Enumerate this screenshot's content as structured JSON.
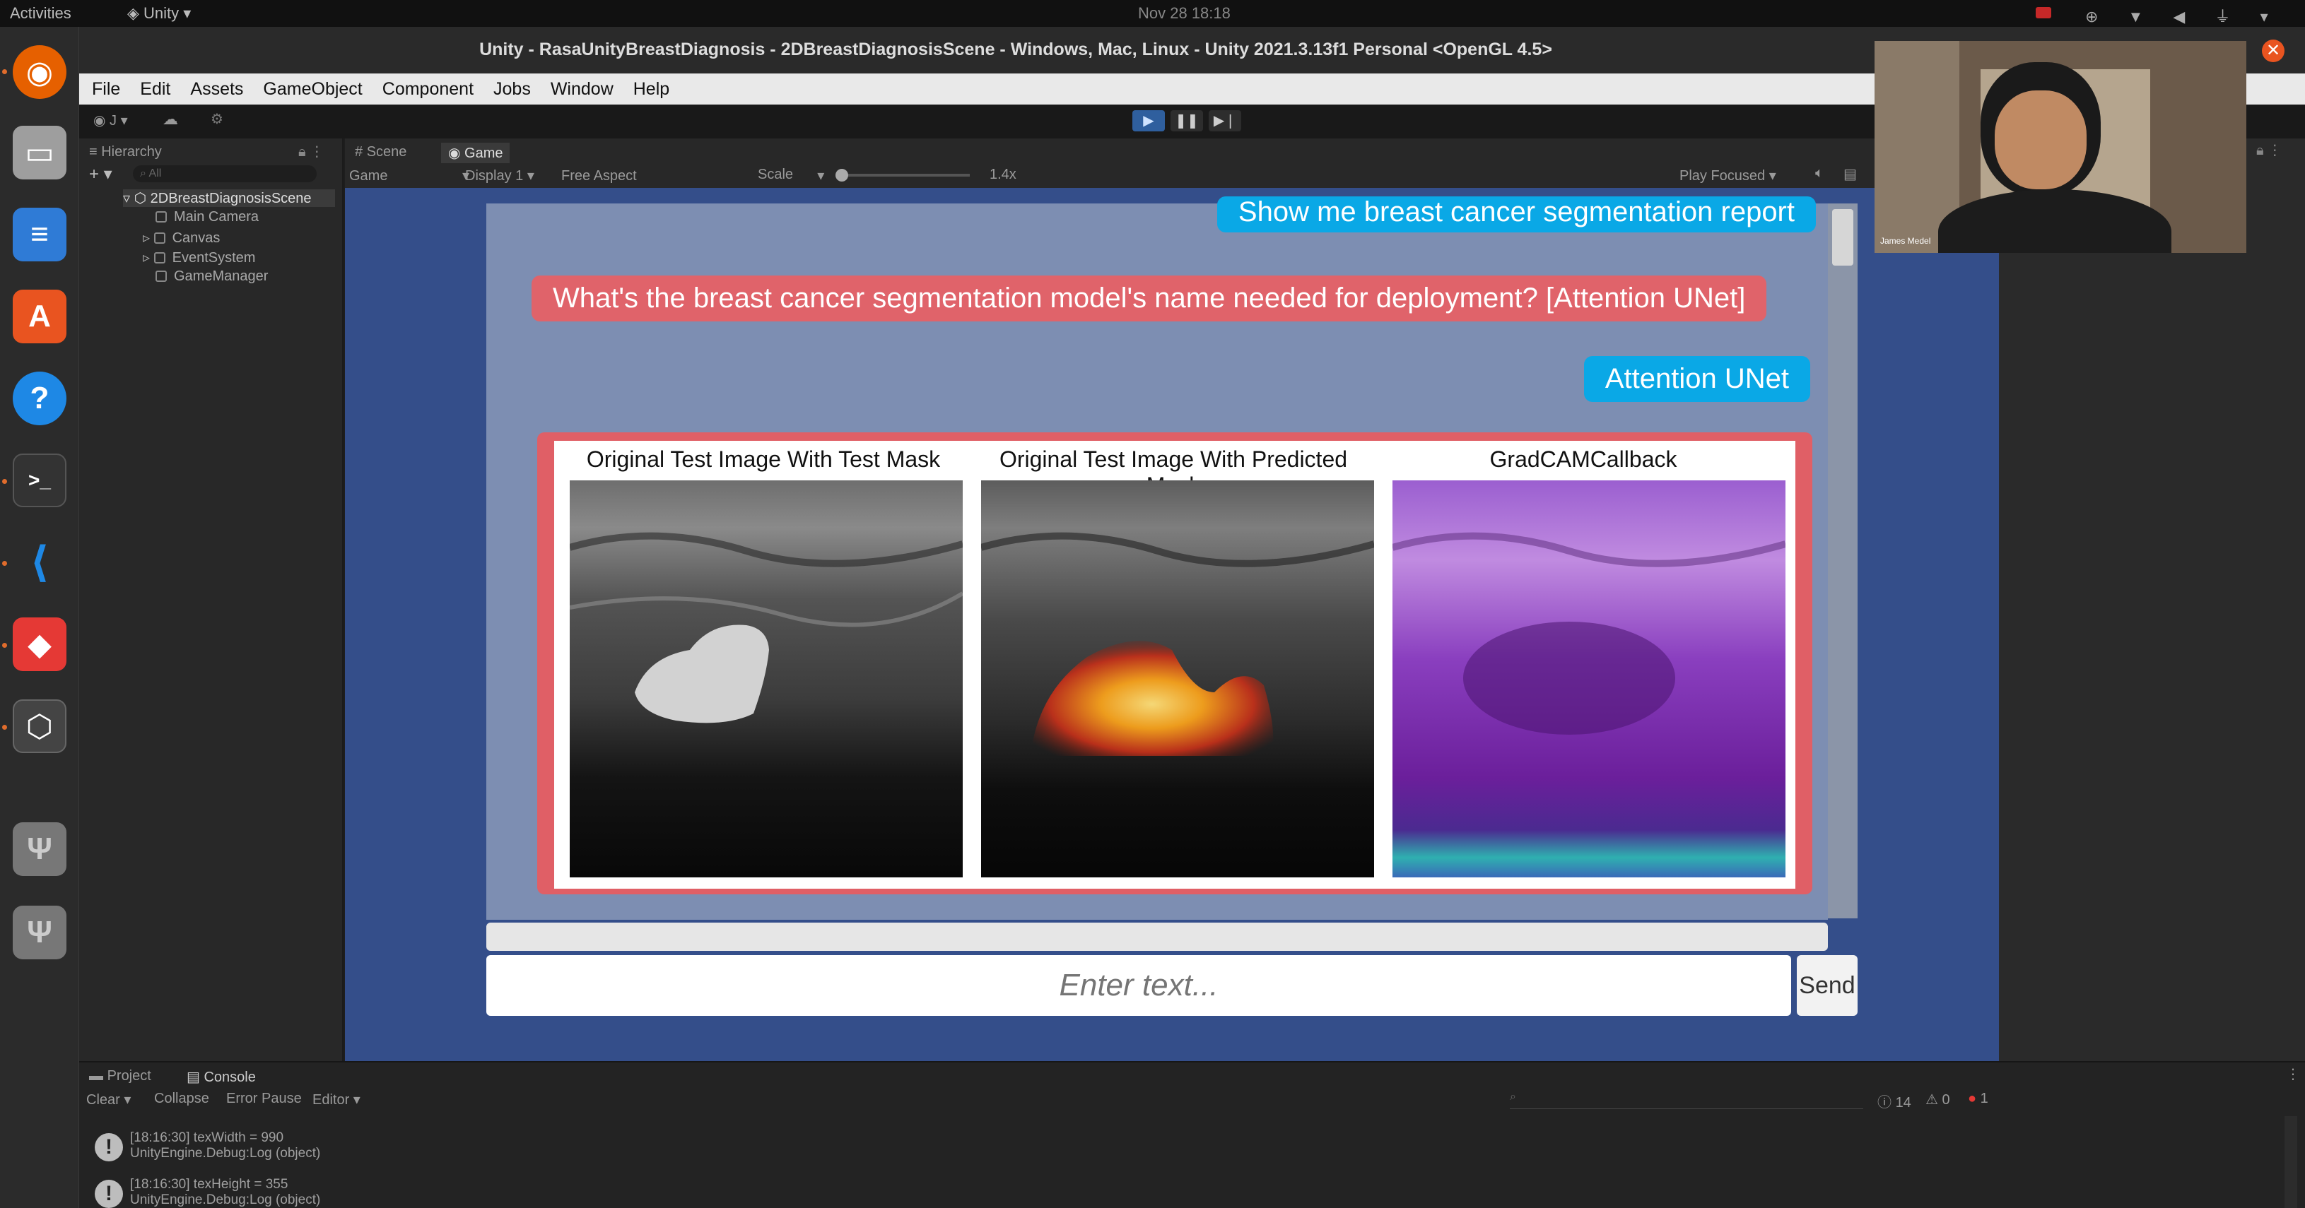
{
  "topbar": {
    "activities": "Activities",
    "app": "Unity",
    "clock": "Nov 28  18:18"
  },
  "dock": [
    "firefox-icon",
    "files-icon",
    "writer-icon",
    "software-icon",
    "help-icon",
    "terminal-icon",
    "vscode-icon",
    "anydesk-icon",
    "unity-icon",
    "usb-icon",
    "usb-icon"
  ],
  "window": {
    "title": "Unity - RasaUnityBreastDiagnosis - 2DBreastDiagnosisScene - Windows, Mac, Linux - Unity 2021.3.13f1 Personal <OpenGL 4.5>"
  },
  "menu": [
    "File",
    "Edit",
    "Assets",
    "GameObject",
    "Component",
    "Jobs",
    "Window",
    "Help"
  ],
  "hierarchy": {
    "tab": "Hierarchy",
    "search": "All",
    "scene": "2DBreastDiagnosisScene",
    "items": [
      "Main Camera",
      "Canvas",
      "EventSystem",
      "GameManager"
    ]
  },
  "game_view": {
    "tabs": [
      "Scene",
      "Game"
    ],
    "mode": "Game",
    "display": "Display 1",
    "aspect": "Free Aspect",
    "scale_label": "Scale",
    "scale_value": "1.4x",
    "play_focused": "Play Focused"
  },
  "chat": {
    "messages": [
      {
        "side": "user",
        "text": "Show me breast cancer segmentation report"
      },
      {
        "side": "bot",
        "text": "What's the breast cancer segmentation model's name needed for deployment? [Attention UNet]"
      },
      {
        "side": "user",
        "text": "Attention UNet"
      }
    ],
    "report_panels": [
      "Original Test Image With Test Mask",
      "Original Test Image With Predicted Mask",
      "GradCAMCallback"
    ],
    "input_placeholder": "Enter text...",
    "send_label": "Send"
  },
  "webcam": {
    "name": "James Medel"
  },
  "console": {
    "tabs": [
      "Project",
      "Console"
    ],
    "toolbar": [
      "Clear",
      "Collapse",
      "Error Pause",
      "Editor"
    ],
    "counts": {
      "info": "14",
      "warn": "0",
      "error": "1"
    },
    "logs": [
      {
        "line1": "[18:16:30] texWidth = 990",
        "line2": "UnityEngine.Debug:Log (object)"
      },
      {
        "line1": "[18:16:30] texHeight = 355",
        "line2": "UnityEngine.Debug:Log (object)"
      }
    ]
  },
  "colors": {
    "game_bg": "#344e8a",
    "chat_bg": "#7d8eb2",
    "user_bubble": "#0aa8e6",
    "bot_bubble": "#e0636a"
  }
}
